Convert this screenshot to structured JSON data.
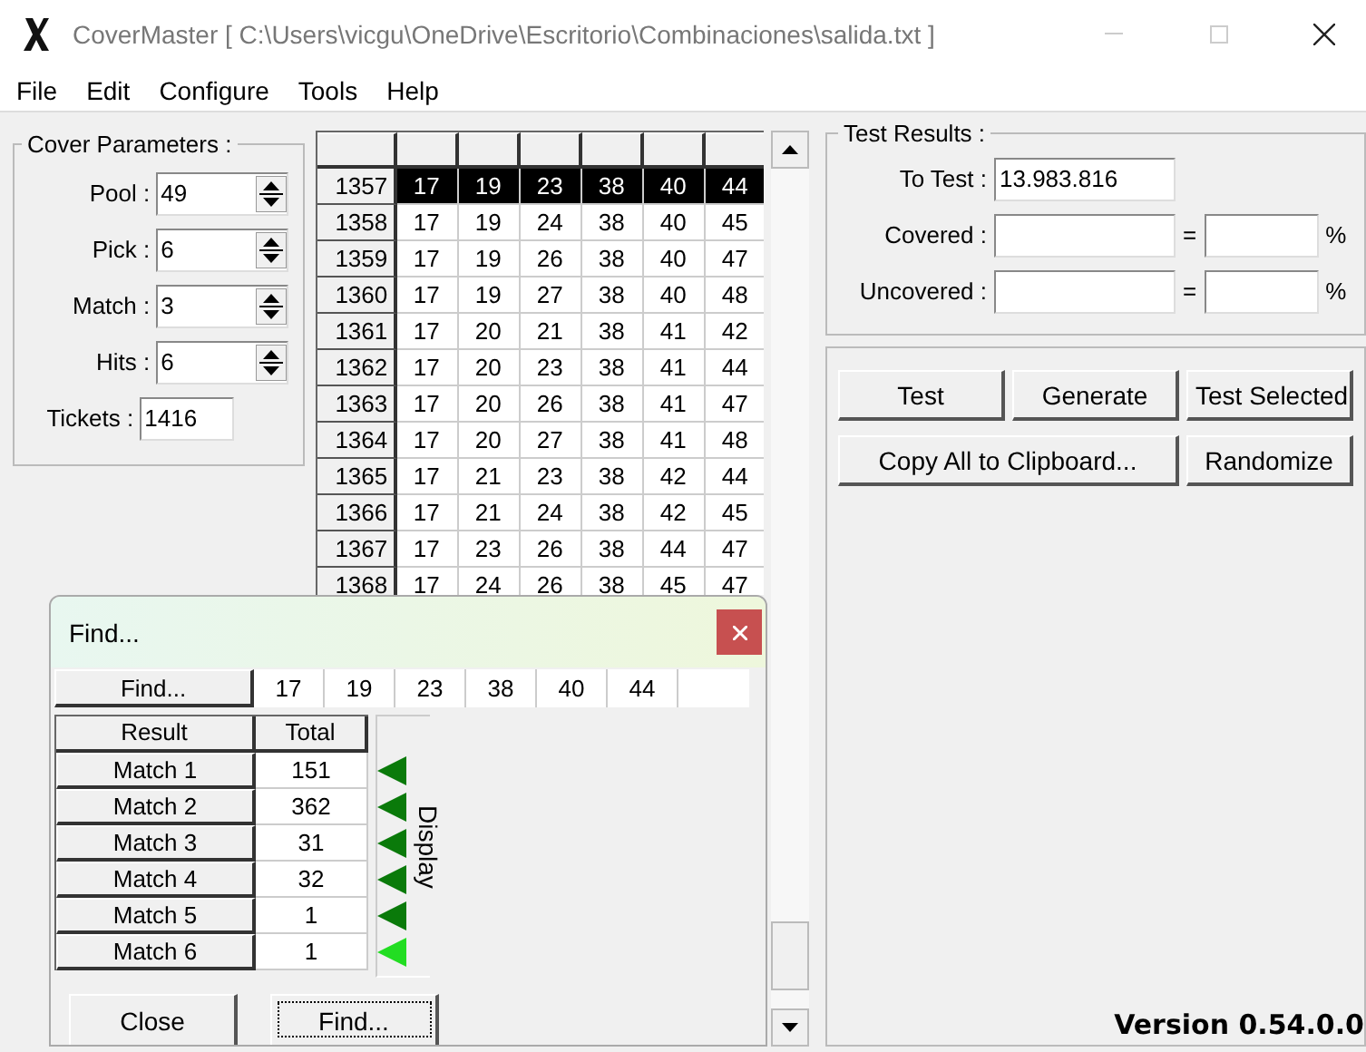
{
  "window": {
    "title": "CoverMaster [ C:\\Users\\vicgu\\OneDrive\\Escritorio\\Combinaciones\\salida.txt ]"
  },
  "menu": [
    "File",
    "Edit",
    "Configure",
    "Tools",
    "Help"
  ],
  "cover_parameters": {
    "title": "Cover Parameters :",
    "fields": [
      {
        "label": "Pool :",
        "value": "49",
        "kind": "spin"
      },
      {
        "label": "Pick :",
        "value": "6",
        "kind": "spin"
      },
      {
        "label": "Match :",
        "value": "3",
        "kind": "spin"
      },
      {
        "label": "Hits :",
        "value": "6",
        "kind": "spin"
      },
      {
        "label": "Tickets :",
        "value": "1416",
        "kind": "text"
      }
    ]
  },
  "grid": {
    "rows": [
      {
        "id": "1357",
        "numbers": [
          "17",
          "19",
          "23",
          "38",
          "40",
          "44"
        ],
        "selected": true
      },
      {
        "id": "1358",
        "numbers": [
          "17",
          "19",
          "24",
          "38",
          "40",
          "45"
        ],
        "selected": false
      },
      {
        "id": "1359",
        "numbers": [
          "17",
          "19",
          "26",
          "38",
          "40",
          "47"
        ],
        "selected": false
      },
      {
        "id": "1360",
        "numbers": [
          "17",
          "19",
          "27",
          "38",
          "40",
          "48"
        ],
        "selected": false
      },
      {
        "id": "1361",
        "numbers": [
          "17",
          "20",
          "21",
          "38",
          "41",
          "42"
        ],
        "selected": false
      },
      {
        "id": "1362",
        "numbers": [
          "17",
          "20",
          "23",
          "38",
          "41",
          "44"
        ],
        "selected": false
      },
      {
        "id": "1363",
        "numbers": [
          "17",
          "20",
          "26",
          "38",
          "41",
          "47"
        ],
        "selected": false
      },
      {
        "id": "1364",
        "numbers": [
          "17",
          "20",
          "27",
          "38",
          "41",
          "48"
        ],
        "selected": false
      },
      {
        "id": "1365",
        "numbers": [
          "17",
          "21",
          "23",
          "38",
          "42",
          "44"
        ],
        "selected": false
      },
      {
        "id": "1366",
        "numbers": [
          "17",
          "21",
          "24",
          "38",
          "42",
          "45"
        ],
        "selected": false
      },
      {
        "id": "1367",
        "numbers": [
          "17",
          "23",
          "26",
          "38",
          "44",
          "47"
        ],
        "selected": false
      },
      {
        "id": "1368",
        "numbers": [
          "17",
          "24",
          "26",
          "38",
          "45",
          "47"
        ],
        "selected": false
      }
    ]
  },
  "test_results": {
    "title": "Test Results :",
    "to_test_label": "To Test :",
    "to_test": "13.983.816",
    "covered_label": "Covered :",
    "uncovered_label": "Uncovered :",
    "equals": "=",
    "percent": "%"
  },
  "buttons": [
    [
      "Test",
      "Generate",
      "Test Selected"
    ],
    [
      "Copy All to Clipboard...",
      "Randomize"
    ]
  ],
  "version": "Version 0.54.0.0",
  "find_dialog": {
    "title": "Find...",
    "find_button": "Find...",
    "numbers": [
      "17",
      "19",
      "23",
      "38",
      "40",
      "44"
    ],
    "columns": [
      "Result",
      "Total"
    ],
    "results": [
      {
        "label": "Match 1",
        "total": "151",
        "selected": false
      },
      {
        "label": "Match 2",
        "total": "362",
        "selected": false
      },
      {
        "label": "Match 3",
        "total": "31",
        "selected": false
      },
      {
        "label": "Match 4",
        "total": "32",
        "selected": false
      },
      {
        "label": "Match 5",
        "total": "1",
        "selected": false
      },
      {
        "label": "Match 6",
        "total": "1",
        "selected": true
      }
    ],
    "display_label": "Display",
    "close_button": "Close",
    "find_bottom_button": "Find..."
  }
}
